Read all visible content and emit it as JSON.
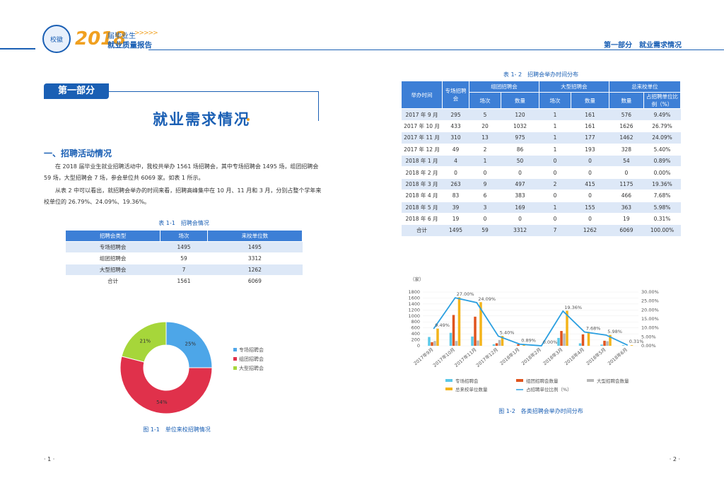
{
  "header": {
    "year": "2018",
    "sub1": "届毕业生",
    "arrows": ">>>>>",
    "sub2": "就业质量报告",
    "right_title": "第一部分　就业需求情况"
  },
  "left": {
    "section_tag": "第一部分",
    "section_title": "就业需求情况",
    "h2": "一、招聘活动情况",
    "para1": "在 2018 届毕业生就业招聘活动中，我校共举办 1561 场招聘会，其中专场招聘会 1495 场，组团招聘会 59 场，大型招聘会 7 场，参会单位共 6069 家。如表 1 所示。",
    "para2": "从表 2 中可以看出，就招聘会举办的时间来看，招聘高峰集中在 10 月、11 月和 3 月，分别占整个学年来校单位的 26.79%、24.09%、19.36%。",
    "table1_caption": "表 1-1　招聘会情况",
    "table1_headers": [
      "招聘会类型",
      "场次",
      "来校单位数"
    ],
    "table1_rows": [
      [
        "专场招聘会",
        "1495",
        "1495"
      ],
      [
        "组团招聘会",
        "59",
        "3312"
      ],
      [
        "大型招聘会",
        "7",
        "1262"
      ],
      [
        "合计",
        "1561",
        "6069"
      ]
    ],
    "pie_caption": "图 1-1　单位来校招聘情况",
    "page_num": "· 1 ·"
  },
  "pie_data": {
    "type": "pie",
    "slices": [
      {
        "name": "专场招聘会",
        "value": 25,
        "label": "25%",
        "color": "#4da6e8"
      },
      {
        "name": "组团招聘会",
        "value": 54,
        "label": "54%",
        "color": "#e0314b"
      },
      {
        "name": "大型招聘会",
        "value": 21,
        "label": "21%",
        "color": "#a6d63a"
      }
    ]
  },
  "right": {
    "table2_caption": "表 1- 2　招聘会举办时间分布",
    "table2_head": {
      "time": "举办时间",
      "special": "专场招聘会",
      "group": "组团招聘会",
      "large": "大型招聘会",
      "total": "总来校单位",
      "count": "场次",
      "qty": "数量",
      "ratio": "占招聘单位比例（%）"
    },
    "table2_rows": [
      [
        "2017 年 9 月",
        "295",
        "5",
        "120",
        "1",
        "161",
        "576",
        "9.49%"
      ],
      [
        "2017 年 10 月",
        "433",
        "20",
        "1032",
        "1",
        "161",
        "1626",
        "26.79%"
      ],
      [
        "2017 年 11 月",
        "310",
        "13",
        "975",
        "1",
        "177",
        "1462",
        "24.09%"
      ],
      [
        "2017 年 12 月",
        "49",
        "2",
        "86",
        "1",
        "193",
        "328",
        "5.40%"
      ],
      [
        "2018 年 1 月",
        "4",
        "1",
        "50",
        "0",
        "0",
        "54",
        "0.89%"
      ],
      [
        "2018 年 2 月",
        "0",
        "0",
        "0",
        "0",
        "0",
        "0",
        "0.00%"
      ],
      [
        "2018 年 3 月",
        "263",
        "9",
        "497",
        "2",
        "415",
        "1175",
        "19.36%"
      ],
      [
        "2018 年 4 月",
        "83",
        "6",
        "383",
        "0",
        "0",
        "466",
        "7.68%"
      ],
      [
        "2018 年 5 月",
        "39",
        "3",
        "169",
        "1",
        "155",
        "363",
        "5.98%"
      ],
      [
        "2018 年 6 月",
        "19",
        "0",
        "0",
        "0",
        "0",
        "19",
        "0.31%"
      ],
      [
        "合计",
        "1495",
        "59",
        "3312",
        "7",
        "1262",
        "6069",
        "100.00%"
      ]
    ],
    "chart_caption": "图 1-2　各类招聘会举办时间分布",
    "page_num": "· 2 ·"
  },
  "chart_data": {
    "type": "bar",
    "unit_label": "（家）",
    "categories": [
      "2017年9月",
      "2017年10月",
      "2017年11月",
      "2017年12月",
      "2018年1月",
      "2018年2月",
      "2018年3月",
      "2018年4月",
      "2018年5月",
      "2018年6月"
    ],
    "series": [
      {
        "name": "专场招聘会",
        "color": "#5bc8e8",
        "values": [
          295,
          433,
          310,
          49,
          4,
          0,
          263,
          83,
          39,
          19
        ]
      },
      {
        "name": "组团招聘会",
        "color": "#f06a2a",
        "values": [
          5,
          20,
          13,
          2,
          1,
          0,
          9,
          6,
          3,
          0
        ]
      },
      {
        "name": "组团招聘会数量",
        "color": "#e0541e",
        "values": [
          120,
          1032,
          975,
          86,
          50,
          0,
          497,
          383,
          169,
          0
        ]
      },
      {
        "name": "大型招聘会数量",
        "color": "#b8b8b8",
        "values": [
          161,
          161,
          177,
          193,
          0,
          0,
          415,
          0,
          155,
          0
        ]
      },
      {
        "name": "总来校单位数量",
        "color": "#f4b41a",
        "values": [
          576,
          1626,
          1462,
          328,
          54,
          0,
          1175,
          466,
          363,
          19
        ]
      }
    ],
    "line": {
      "name": "占招聘单位比例（%）",
      "color": "#2b9fe0",
      "values": [
        9.49,
        26.79,
        24.09,
        5.4,
        0.89,
        0.0,
        19.36,
        7.68,
        5.98,
        0.31
      ],
      "labels": [
        "9.49%",
        "27.00%",
        "24.09%",
        "5.40%",
        "0.89%",
        "0.00%",
        "19.36%",
        "7.68%",
        "5.98%",
        "0.31%"
      ]
    },
    "y_left": {
      "ticks": [
        "1800",
        "1600",
        "1400",
        "1200",
        "1000",
        "800",
        "600",
        "400",
        "200",
        "0"
      ],
      "max": 1800
    },
    "y_right": {
      "ticks": [
        "30.00%",
        "25.00%",
        "20.00%",
        "15.00%",
        "10.00%",
        "5.00%",
        "0.00%"
      ],
      "max": 30
    },
    "legend": [
      "专场招聘会",
      "组团招聘会数量",
      "大型招聘会数量",
      "总来校单位数量",
      "占招聘单位比例（%）"
    ]
  }
}
